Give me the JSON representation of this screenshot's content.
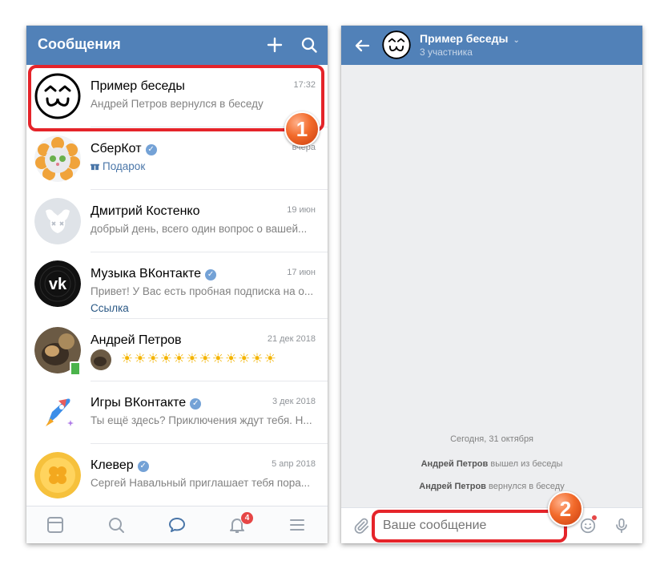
{
  "left": {
    "header": {
      "title": "Сообщения"
    },
    "conversations": [
      {
        "name": "Пример беседы",
        "verified": false,
        "message": "Андрей Петров вернулся в беседу",
        "date": "17:32",
        "link": ""
      },
      {
        "name": "СберКот",
        "verified": true,
        "message": "Подарок",
        "date": "вчера",
        "link": ""
      },
      {
        "name": "Дмитрий Костенко",
        "verified": false,
        "message": "добрый день, всего один вопрос о вашей...",
        "date": "19 июн",
        "link": ""
      },
      {
        "name": "Музыка ВКонтакте",
        "verified": true,
        "message": "Привет! У Вас есть пробная подписка на о...",
        "date": "17 июн",
        "link": "Ссылка"
      },
      {
        "name": "Андрей Петров",
        "verified": false,
        "message": "",
        "date": "21 дек 2018",
        "link": ""
      },
      {
        "name": "Игры ВКонтакте",
        "verified": true,
        "message": "Ты ещё здесь? Приключения ждут тебя. Н...",
        "date": "3 дек 2018",
        "link": ""
      },
      {
        "name": "Клевер",
        "verified": true,
        "message": "Сергей Навальный приглашает тебя пора...",
        "date": "5 апр 2018",
        "link": ""
      }
    ],
    "tabbar": {
      "notifications_badge": "4"
    },
    "step_label": "1"
  },
  "right": {
    "header": {
      "title": "Пример беседы",
      "subtitle": "3 участника"
    },
    "date_divider": "Сегодня, 31 октября",
    "events": [
      {
        "actor": "Андрей Петров",
        "action": "вышел из беседы"
      },
      {
        "actor": "Андрей Петров",
        "action": "вернулся в беседу"
      }
    ],
    "input": {
      "placeholder": "Ваше сообщение"
    },
    "step_label": "2"
  },
  "colors": {
    "header": "#5181b8",
    "highlight": "#e5242a",
    "link": "#2a5885",
    "badge": "#e64646"
  }
}
